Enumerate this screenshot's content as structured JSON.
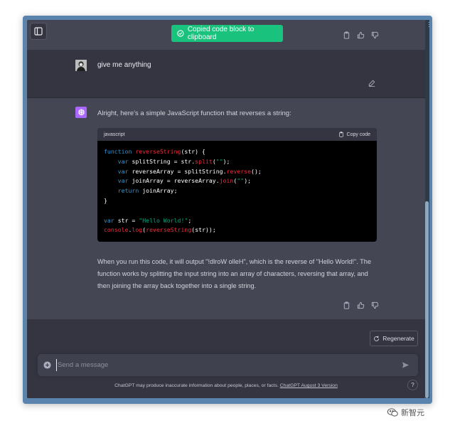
{
  "toast": {
    "text": "Copied code block to clipboard"
  },
  "user_message": {
    "text": "give me anything"
  },
  "assistant_message": {
    "intro": "Alright, here's a simple JavaScript function that reverses a string:",
    "code_block": {
      "language": "javascript",
      "copy_label": "Copy code",
      "lines": [
        [
          {
            "t": "function ",
            "c": "kw"
          },
          {
            "t": "reverseString",
            "c": "fn"
          },
          {
            "t": "(str) {",
            "c": ""
          }
        ],
        [
          {
            "t": "    ",
            "c": ""
          },
          {
            "t": "var ",
            "c": "kw"
          },
          {
            "t": "splitString = str.",
            "c": ""
          },
          {
            "t": "split",
            "c": "fn"
          },
          {
            "t": "(",
            "c": ""
          },
          {
            "t": "\"\"",
            "c": "str"
          },
          {
            "t": ");",
            "c": ""
          }
        ],
        [
          {
            "t": "    ",
            "c": ""
          },
          {
            "t": "var ",
            "c": "kw"
          },
          {
            "t": "reverseArray = splitString.",
            "c": ""
          },
          {
            "t": "reverse",
            "c": "fn"
          },
          {
            "t": "();",
            "c": ""
          }
        ],
        [
          {
            "t": "    ",
            "c": ""
          },
          {
            "t": "var ",
            "c": "kw"
          },
          {
            "t": "joinArray = reverseArray.",
            "c": ""
          },
          {
            "t": "join",
            "c": "fn"
          },
          {
            "t": "(",
            "c": ""
          },
          {
            "t": "\"\"",
            "c": "str"
          },
          {
            "t": ");",
            "c": ""
          }
        ],
        [
          {
            "t": "    ",
            "c": ""
          },
          {
            "t": "return ",
            "c": "kw"
          },
          {
            "t": "joinArray;",
            "c": ""
          }
        ],
        [
          {
            "t": "}",
            "c": ""
          }
        ],
        [],
        [
          {
            "t": "var ",
            "c": "kw"
          },
          {
            "t": "str = ",
            "c": ""
          },
          {
            "t": "\"Hello World!\"",
            "c": "str"
          },
          {
            "t": ";",
            "c": ""
          }
        ],
        [
          {
            "t": "console",
            "c": "fn"
          },
          {
            "t": ".",
            "c": ""
          },
          {
            "t": "log",
            "c": "fn"
          },
          {
            "t": "(",
            "c": ""
          },
          {
            "t": "reverseString",
            "c": "fn"
          },
          {
            "t": "(str));",
            "c": ""
          }
        ]
      ]
    },
    "explanation": "When you run this code, it will output \"!dlroW olleH\", which is the reverse of \"Hello World!\". The function works by splitting the input string into an array of characters, reversing that array, and then joining the array back together into a single string."
  },
  "composer": {
    "regenerate_label": "Regenerate",
    "input_value": "",
    "input_placeholder": "Send a message",
    "disclaimer_text": "ChatGPT may produce inaccurate information about people, places, or facts. ",
    "version_link": "ChatGPT August 3 Version",
    "help_label": "?"
  },
  "watermark": {
    "text": "新智元"
  },
  "colors": {
    "background": "#343541",
    "assistant_background": "#444654",
    "toast_green": "#19c37d",
    "keyword": "#2e95d3",
    "function": "#f22c3d",
    "string": "#00a67d",
    "gpt_avatar": "#ab68ff"
  },
  "icons": [
    "sidebar-toggle-icon",
    "check-circle-icon",
    "clipboard-icon",
    "thumbs-up-icon",
    "thumbs-down-icon",
    "edit-icon",
    "openai-logo-icon",
    "plus-circle-icon",
    "send-icon",
    "refresh-icon",
    "wechat-icon"
  ]
}
